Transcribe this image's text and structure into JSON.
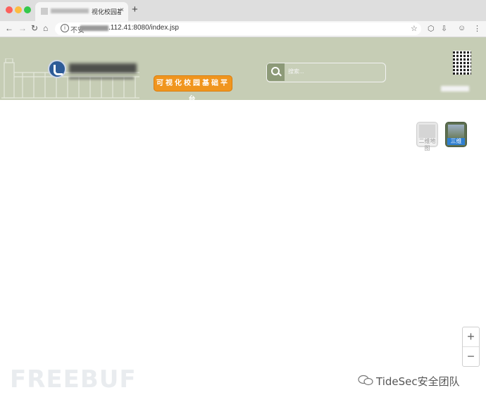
{
  "browser": {
    "tab_title": "视化校园基础平",
    "tab_close": "×",
    "new_tab": "+",
    "address": {
      "insecure_label": "不安",
      "url": ".112.41:8080/index.jsp"
    },
    "icons": [
      "back-arrow-icon",
      "forward-arrow-icon",
      "reload-icon",
      "home-icon",
      "info-icon",
      "star-icon",
      "extension-icon",
      "download-icon",
      "profile-icon",
      "menu-icon"
    ]
  },
  "header": {
    "platform_badge": "可视化校园基础平台",
    "search_placeholder": "搜索...",
    "background_color": "#c6cdb5",
    "badge_color": "#f0951e"
  },
  "map": {
    "maptype_2d_label": "二维地图",
    "maptype_3d_label": "三维",
    "zoom_in": "+",
    "zoom_out": "−"
  },
  "watermarks": {
    "freebuf": "FREEBUF",
    "tidesec": "TideSec安全团队"
  }
}
